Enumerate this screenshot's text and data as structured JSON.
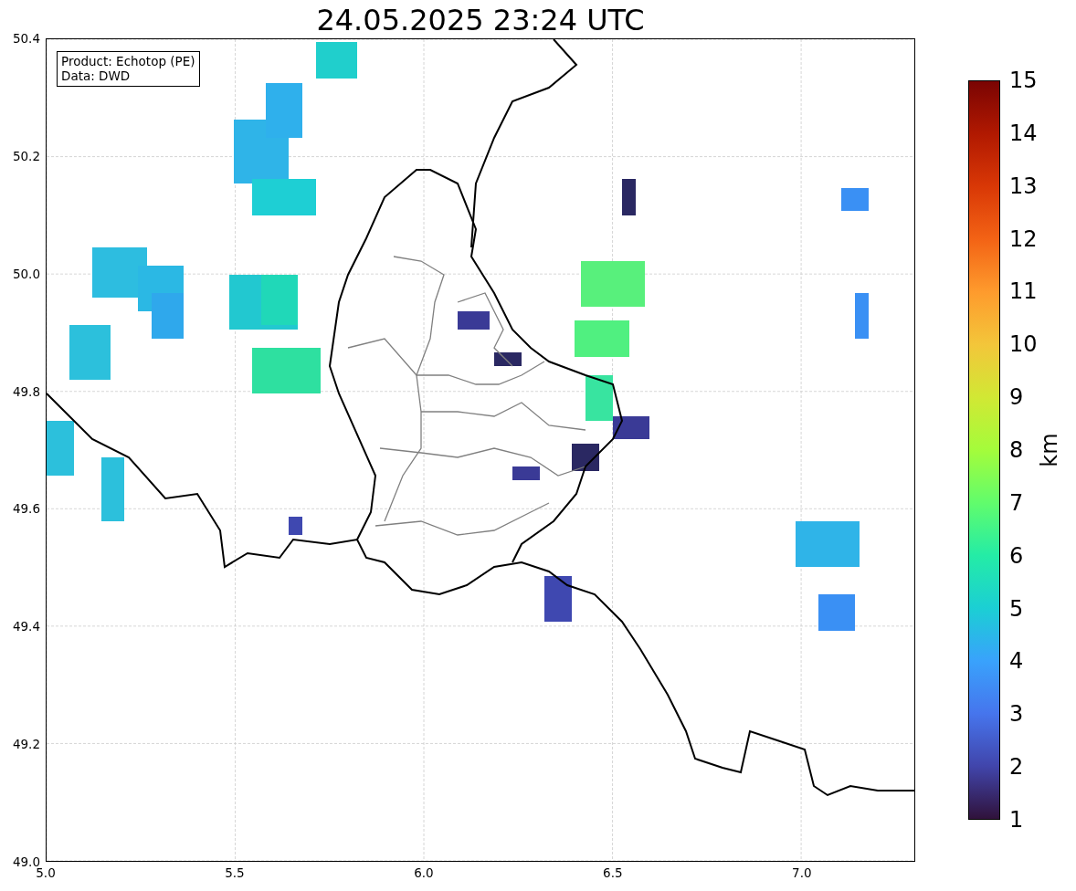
{
  "title": "24.05.2025 23:24 UTC",
  "info_box": [
    "Product: Echotop (PE)",
    "Data: DWD"
  ],
  "xticks": [
    "5.0",
    "5.5",
    "6.0",
    "6.5",
    "7.0"
  ],
  "yticks": [
    "50.4",
    "50.2",
    "50.0",
    "49.8",
    "49.6",
    "49.4",
    "49.2",
    "49.0"
  ],
  "colorbar": {
    "ticks": [
      "15",
      "14",
      "13",
      "12",
      "11",
      "10",
      "9",
      "8",
      "7",
      "6",
      "5",
      "4",
      "3",
      "2",
      "1"
    ],
    "label": "km"
  }
}
